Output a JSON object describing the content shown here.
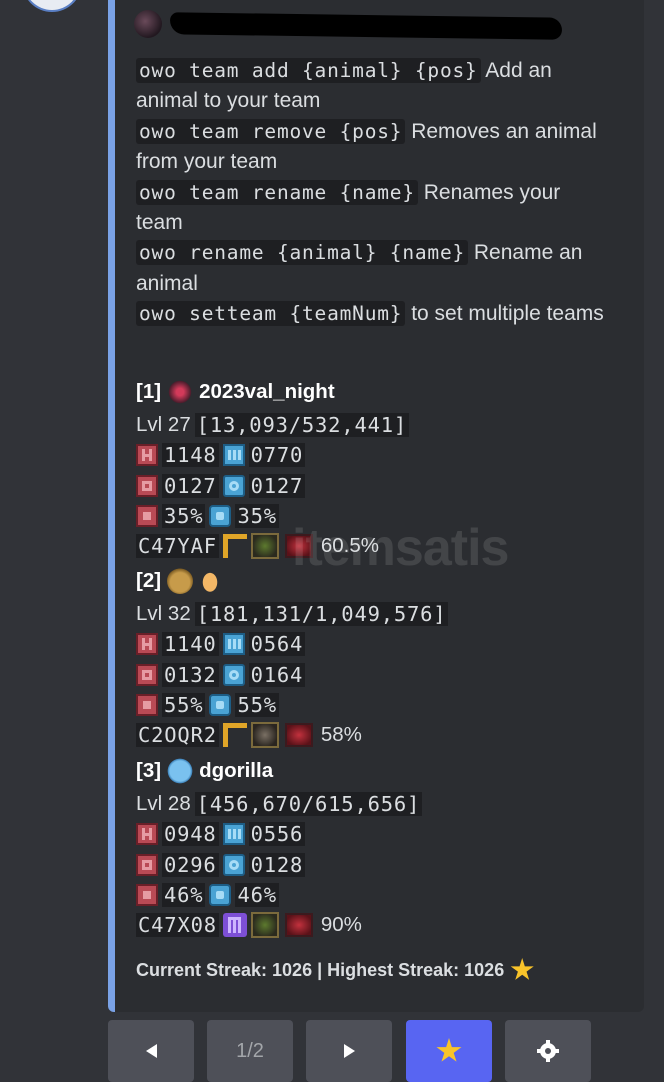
{
  "commands": [
    {
      "code": "owo team add {animal} {pos}",
      "text": "Add an animal to your team"
    },
    {
      "code": "owo team remove {pos}",
      "text": "Removes an animal from your team"
    },
    {
      "code": "owo team rename {name}",
      "text": "Renames your team"
    },
    {
      "code": "owo rename {animal} {name}",
      "text": "Rename an animal"
    },
    {
      "code": "owo setteam {teamNum}",
      "text": "to set multiple teams"
    }
  ],
  "teams": [
    {
      "index": "[1]",
      "name": "2023val_night",
      "lvl_label": "Lvl",
      "level": "27",
      "xp": "[13,093/532,441]",
      "hp": "1148",
      "wp": "0770",
      "att": "0127",
      "mag": "0127",
      "pr": "35%",
      "mr": "35%",
      "code": "C47YAF",
      "percent": "60.5%",
      "rank_icon": "corner-rank-icon",
      "weapon_icon": "green-weapon-icon"
    },
    {
      "index": "[2]",
      "name": "",
      "lvl_label": "Lvl",
      "level": "32",
      "xp": "[181,131/1,049,576]",
      "hp": "1140",
      "wp": "0564",
      "att": "0132",
      "mag": "0164",
      "pr": "55%",
      "mr": "55%",
      "code": "C2OQR2",
      "percent": "58%",
      "rank_icon": "corner-rank-icon",
      "weapon_icon": "dark-weapon-icon"
    },
    {
      "index": "[3]",
      "name": "dgorilla",
      "lvl_label": "Lvl",
      "level": "28",
      "xp": "[456,670/615,656]",
      "hp": "0948",
      "wp": "0556",
      "att": "0296",
      "mag": "0128",
      "pr": "46%",
      "mr": "46%",
      "code": "C47X08",
      "percent": "90%",
      "rank_icon": "mythic-rank-icon",
      "weapon_icon": "green-weapon-icon"
    }
  ],
  "streak": "Current Streak: 1026 | Highest Streak: 1026",
  "watermark": "itemsatis",
  "pagination": {
    "page": "1/2"
  },
  "colors": {
    "accent_bar": "#7aa2e6",
    "primary_button": "#5865f2",
    "button": "#4e5058"
  }
}
